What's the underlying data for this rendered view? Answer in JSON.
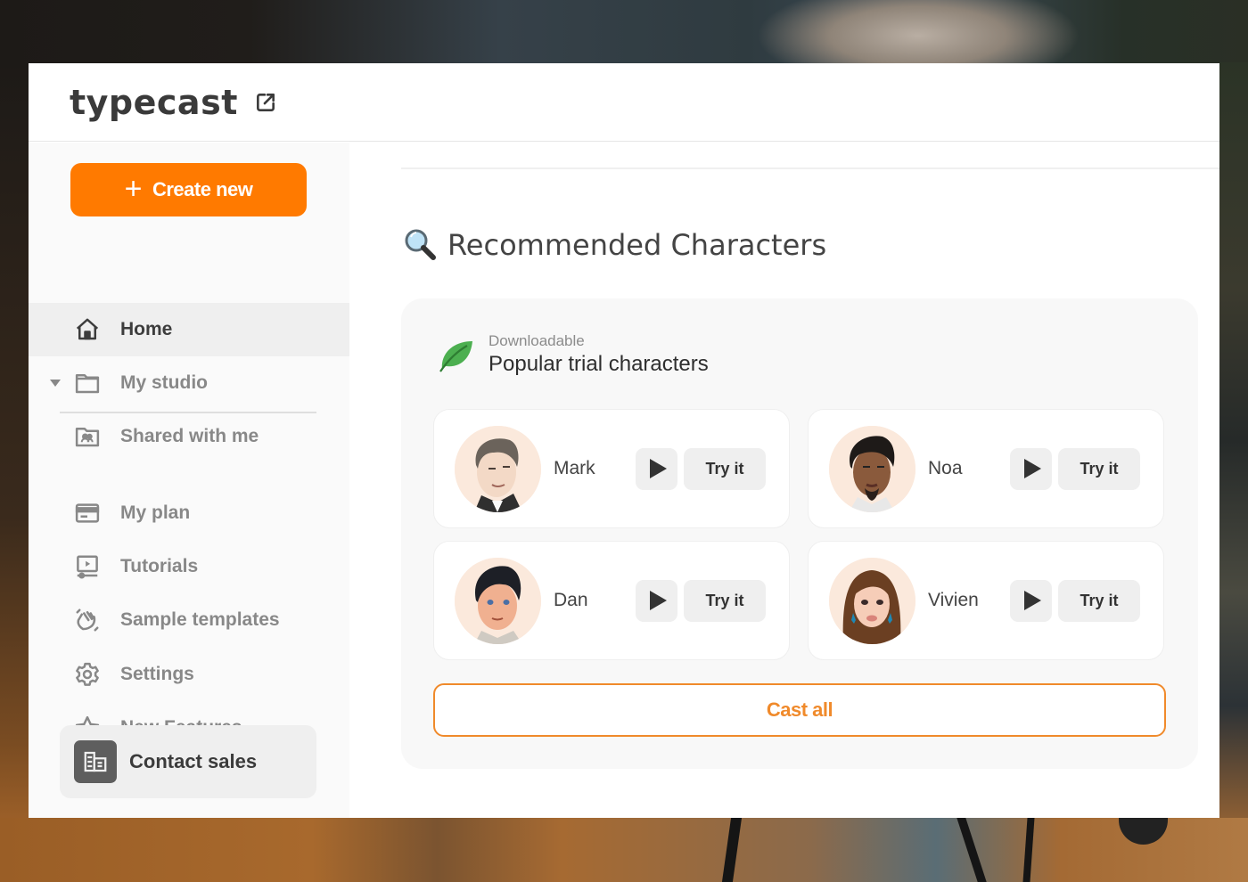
{
  "app": {
    "logo_text": "typecast",
    "external_link_icon": "external-link-icon"
  },
  "sidebar": {
    "create_button": {
      "label": "Create new",
      "icon": "plus-icon",
      "color": "#ff7a00"
    },
    "items": [
      {
        "label": "Home",
        "icon": "home-icon",
        "active": true
      },
      {
        "label": "My studio",
        "icon": "folder-icon",
        "expandable": true
      },
      {
        "label": "Shared with me",
        "icon": "shared-folder-icon"
      },
      {
        "label": "My plan",
        "icon": "credit-card-icon"
      },
      {
        "label": "Tutorials",
        "icon": "video-player-icon"
      },
      {
        "label": "Sample templates",
        "icon": "waving-hand-icon"
      },
      {
        "label": "Settings",
        "icon": "gear-icon"
      },
      {
        "label": "New Features",
        "icon": "star-icon"
      }
    ],
    "contact_sales": {
      "label": "Contact sales",
      "icon": "building-icon"
    }
  },
  "main": {
    "section_title": "Recommended Characters",
    "section_icon": "magnifying-glass-icon",
    "panel": {
      "icon": "leaf-icon",
      "subtitle": "Downloadable",
      "title": "Popular trial characters",
      "characters": [
        {
          "name": "Mark",
          "try_label": "Try it",
          "play_icon": "play-icon"
        },
        {
          "name": "Noa",
          "try_label": "Try it",
          "play_icon": "play-icon"
        },
        {
          "name": "Dan",
          "try_label": "Try it",
          "play_icon": "play-icon"
        },
        {
          "name": "Vivien",
          "try_label": "Try it",
          "play_icon": "play-icon"
        }
      ],
      "cast_all_label": "Cast all",
      "accent_color": "#f08a2b"
    }
  }
}
